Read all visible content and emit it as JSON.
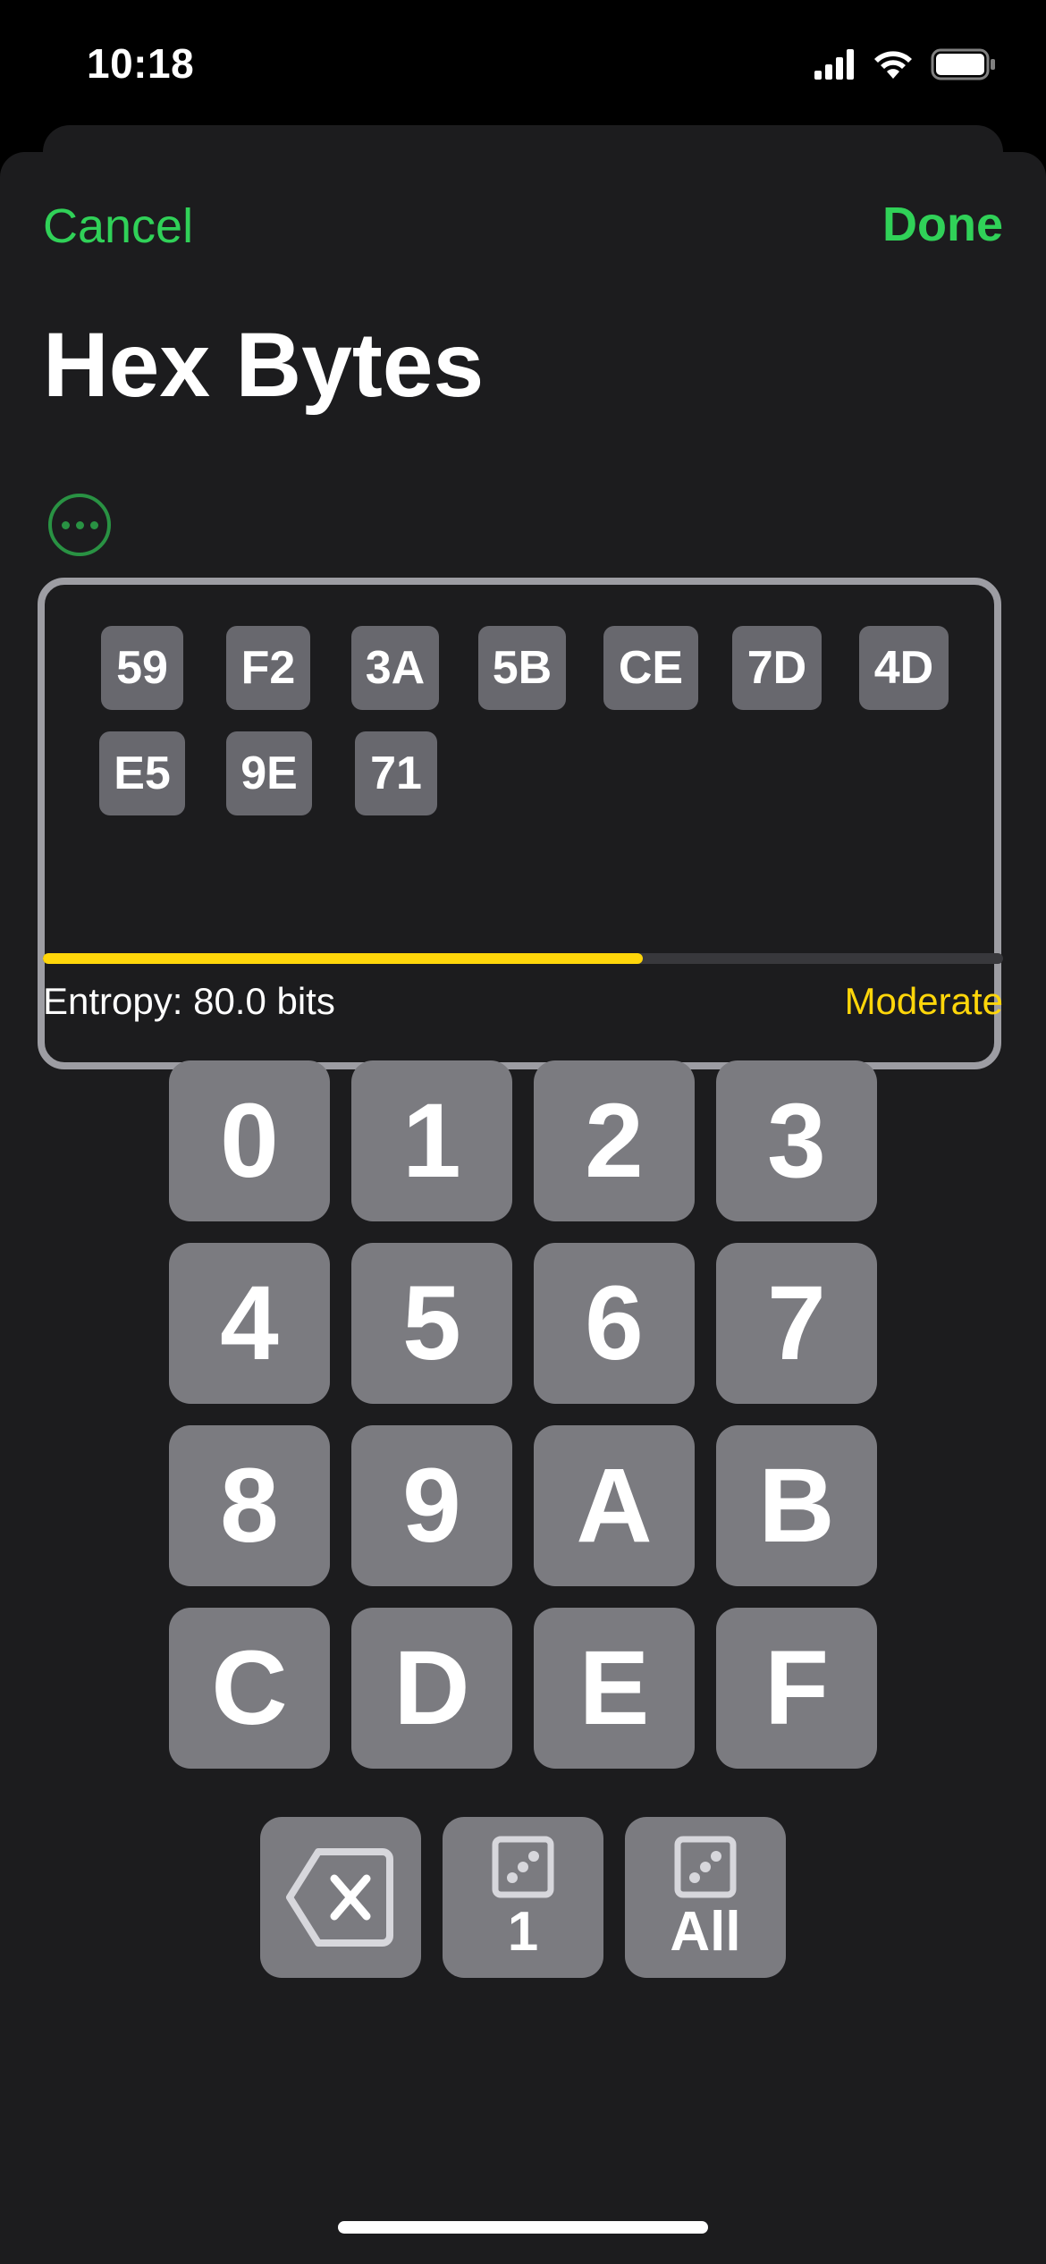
{
  "status_bar": {
    "time": "10:18"
  },
  "nav": {
    "cancel_label": "Cancel",
    "done_label": "Done"
  },
  "title": "Hex Bytes",
  "bytes": [
    "59",
    "F2",
    "3A",
    "5B",
    "CE",
    "7D",
    "4D",
    "E5",
    "9E",
    "71"
  ],
  "entropy": {
    "label": "Entropy: 80.0 bits",
    "strength": "Moderate",
    "fraction": 0.625
  },
  "keys": [
    "0",
    "1",
    "2",
    "3",
    "4",
    "5",
    "6",
    "7",
    "8",
    "9",
    "A",
    "B",
    "C",
    "D",
    "E",
    "F"
  ],
  "actions": {
    "roll_one_label": "1",
    "roll_all_label": "All"
  },
  "colors": {
    "accent": "#30d158",
    "warning": "#ffd60a",
    "key_bg": "#7b7b80",
    "sheet_bg": "#1c1c1e"
  },
  "icons": {
    "delete": "delete-backward-icon",
    "dice": "die-face-icon",
    "more": "ellipsis-circle-icon"
  }
}
